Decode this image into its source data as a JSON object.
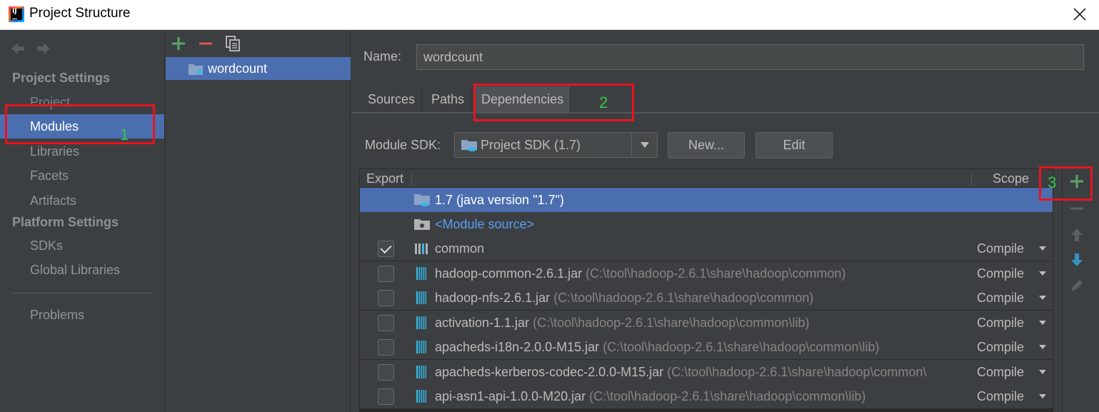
{
  "window": {
    "title": "Project Structure",
    "app_icon_letters": "IJ"
  },
  "sidebar": {
    "sections": [
      {
        "label": "Project Settings",
        "items": [
          "Project",
          "Modules",
          "Libraries",
          "Facets",
          "Artifacts"
        ]
      },
      {
        "label": "Platform Settings",
        "items": [
          "SDKs",
          "Global Libraries"
        ]
      }
    ],
    "extra_item": "Problems",
    "selected_item": "Modules"
  },
  "module_list": {
    "modules": [
      "wordcount"
    ],
    "selected": "wordcount"
  },
  "module_detail": {
    "name_label": "Name:",
    "name_value": "wordcount",
    "tabs": [
      "Sources",
      "Paths",
      "Dependencies"
    ],
    "active_tab": "Dependencies",
    "sdk_label": "Module SDK:",
    "sdk_value": "Project SDK (1.7)",
    "new_button": "New...",
    "edit_button": "Edit"
  },
  "dependencies": {
    "columns": [
      "Export",
      "Scope"
    ],
    "rows": [
      {
        "checkbox": false,
        "icon": "sdk-folder-icon",
        "name": "1.7 (java version \"1.7\")",
        "path": "",
        "scope": "",
        "selected": true
      },
      {
        "checkbox": false,
        "icon": "module-source-icon",
        "name": "<Module source>",
        "path": "",
        "scope": "",
        "link": true
      },
      {
        "checkbox": true,
        "checked": true,
        "icon": "library-icon",
        "name": "common",
        "path": "",
        "scope": "Compile"
      },
      {
        "checkbox": true,
        "checked": false,
        "icon": "jar-icon",
        "name": "hadoop-common-2.6.1.jar",
        "path": "(C:\\tool\\hadoop-2.6.1\\share\\hadoop\\common)",
        "scope": "Compile"
      },
      {
        "checkbox": true,
        "checked": false,
        "icon": "jar-icon",
        "name": "hadoop-nfs-2.6.1.jar",
        "path": "(C:\\tool\\hadoop-2.6.1\\share\\hadoop\\common)",
        "scope": "Compile"
      },
      {
        "checkbox": true,
        "checked": false,
        "icon": "jar-icon",
        "name": "activation-1.1.jar",
        "path": "(C:\\tool\\hadoop-2.6.1\\share\\hadoop\\common\\lib)",
        "scope": "Compile"
      },
      {
        "checkbox": true,
        "checked": false,
        "icon": "jar-icon",
        "name": "apacheds-i18n-2.0.0-M15.jar",
        "path": "(C:\\tool\\hadoop-2.6.1\\share\\hadoop\\common\\lib)",
        "scope": "Compile"
      },
      {
        "checkbox": true,
        "checked": false,
        "icon": "jar-icon",
        "name": "apacheds-kerberos-codec-2.0.0-M15.jar",
        "path": "(C:\\tool\\hadoop-2.6.1\\share\\hadoop\\common\\",
        "scope": "Compile"
      },
      {
        "checkbox": true,
        "checked": false,
        "icon": "jar-icon",
        "name": "api-asn1-api-1.0.0-M20.jar",
        "path": "(C:\\tool\\hadoop-2.6.1\\share\\hadoop\\common\\lib)",
        "scope": "Compile"
      }
    ]
  },
  "annotations": [
    "1",
    "2",
    "3"
  ],
  "colors": {
    "selection": "#4b6eaf",
    "annotation_box": "#e8141f",
    "annotation_number": "#35c94a",
    "add_icon": "#59a869",
    "remove_icon": "#e05555"
  }
}
